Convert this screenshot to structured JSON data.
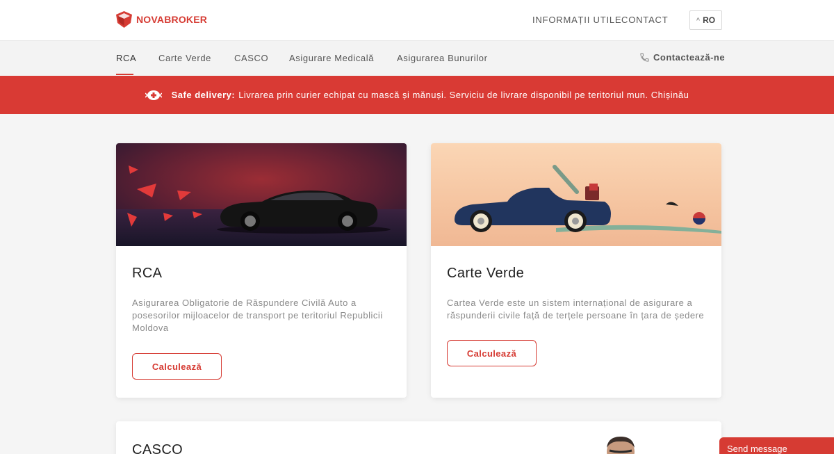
{
  "brand": {
    "name": "NOVABROKER",
    "accent": "#d63b33"
  },
  "top_nav": {
    "links": [
      "INFORMAȚII UTILE",
      "CONTACT"
    ],
    "lang": "RO"
  },
  "main_nav": {
    "items": [
      "RCA",
      "Carte Verde",
      "CASCO",
      "Asigurare Medicală",
      "Asigurarea Bunurilor"
    ],
    "active": "RCA",
    "contact": "Contactează-ne"
  },
  "banner": {
    "label": "Safe delivery:",
    "text": "Livrarea prin curier echipat cu mască și mănuși. Serviciu de livrare disponibil pe teritoriul mun. Chișinău"
  },
  "cards": [
    {
      "title": "RCA",
      "description": "Asigurarea Obligatorie de Răspundere Civilă Auto a posesorilor mijloacelor de transport pe teritoriul Republicii Moldova",
      "button": "Calculează"
    },
    {
      "title": "Carte Verde",
      "description": "Cartea Verde este un sistem internațional de asigurare a răspunderii civile față de terțele persoane în țara de ședere",
      "button": "Calculează"
    }
  ],
  "casco_card": {
    "title": "CASCO"
  },
  "chat": {
    "label": "Send message"
  }
}
